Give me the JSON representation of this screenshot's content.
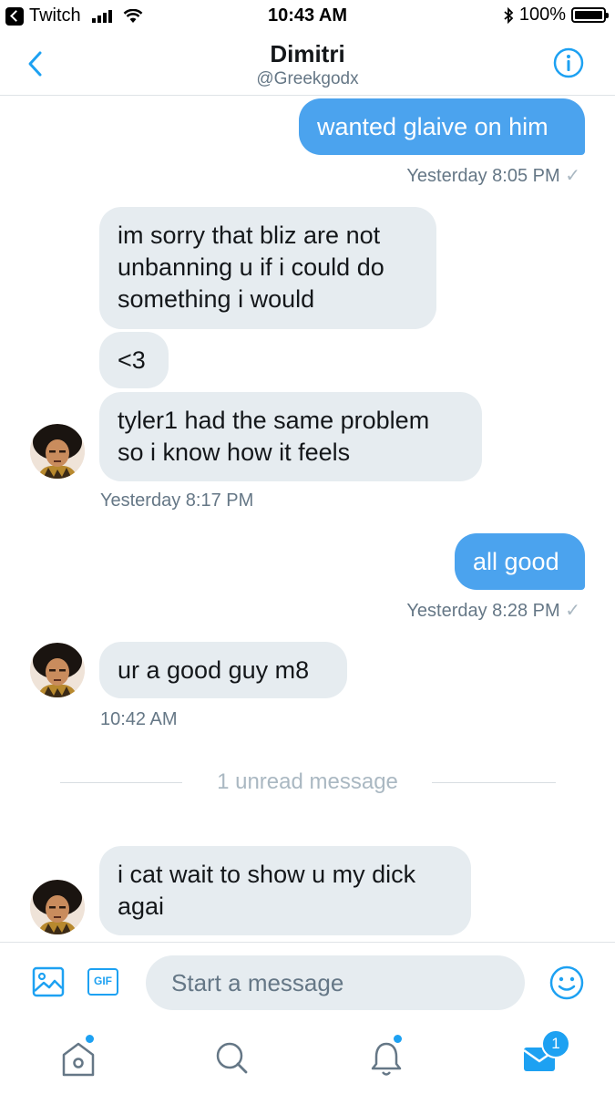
{
  "status_bar": {
    "back_app_label": "Twitch",
    "time": "10:43 AM",
    "battery": "100%"
  },
  "header": {
    "name": "Dimitri",
    "handle": "@Greekgodx"
  },
  "messages": [
    {
      "dir": "out",
      "text": "wanted glaive on him"
    },
    {
      "meta": "Yesterday 8:05 PM",
      "check": "✓"
    },
    {
      "dir": "in",
      "lines": [
        "im sorry that bliz are not",
        "unbanning u if i could do",
        "something i would"
      ]
    },
    {
      "dir": "in",
      "text": "<3"
    },
    {
      "dir": "in",
      "lines": [
        "tyler1 had the same problem",
        "so i know how it feels"
      ]
    },
    {
      "meta": "Yesterday 8:17 PM"
    },
    {
      "dir": "out",
      "text": "all good"
    },
    {
      "meta": "Yesterday 8:28 PM",
      "check": "✓"
    },
    {
      "dir": "in",
      "text": "ur a good guy m8"
    },
    {
      "meta": "10:42 AM"
    },
    {
      "divider": "1 unread message"
    },
    {
      "dir": "in",
      "lines": [
        "i cat wait to show u my dick",
        "agai"
      ]
    }
  ],
  "composer": {
    "placeholder": "Start a message",
    "gif_label": "GIF"
  },
  "tabs": {
    "messages_badge": "1"
  },
  "colors": {
    "accent": "#1da1f2",
    "outgoing_bubble": "#4ba3ee",
    "incoming_bubble": "#e6ecf0",
    "meta_text": "#657786"
  },
  "icons": [
    "chevron-left-icon",
    "info-icon",
    "image-icon",
    "gif-icon",
    "emoji-icon",
    "home-icon",
    "search-icon",
    "bell-icon",
    "envelope-icon",
    "avatar"
  ]
}
